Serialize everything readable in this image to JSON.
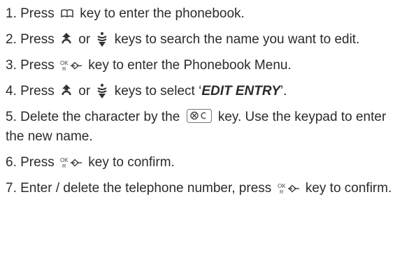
{
  "steps": [
    {
      "num": "1.",
      "parts": [
        {
          "t": "text",
          "v": " Press "
        },
        {
          "t": "icon",
          "name": "phonebook-key-icon"
        },
        {
          "t": "text",
          "v": " key to enter the phonebook."
        }
      ]
    },
    {
      "num": "2.",
      "parts": [
        {
          "t": "text",
          "v": " Press "
        },
        {
          "t": "icon",
          "name": "up-key-icon"
        },
        {
          "t": "text",
          "v": " or "
        },
        {
          "t": "icon",
          "name": "down-key-icon"
        },
        {
          "t": "text",
          "v": " keys to search the name you want to edit."
        }
      ]
    },
    {
      "num": "3.",
      "parts": [
        {
          "t": "text",
          "v": " Press "
        },
        {
          "t": "icon",
          "name": "ok-redial-key-icon"
        },
        {
          "t": "text",
          "v": " key to enter the Phonebook Menu."
        }
      ]
    },
    {
      "num": "4.",
      "parts": [
        {
          "t": "text",
          "v": " Press "
        },
        {
          "t": "icon",
          "name": "up-key-icon"
        },
        {
          "t": "text",
          "v": " or "
        },
        {
          "t": "icon",
          "name": "down-key-icon"
        },
        {
          "t": "text",
          "v": " keys to select ‘"
        },
        {
          "t": "em",
          "v": "EDIT ENTRY"
        },
        {
          "t": "text",
          "v": "’."
        }
      ]
    },
    {
      "num": "5.",
      "parts": [
        {
          "t": "text",
          "v": " Delete the character by the "
        },
        {
          "t": "icon",
          "name": "clear-key-icon"
        },
        {
          "t": "text",
          "v": " key. Use the keypad to enter the new name."
        }
      ]
    },
    {
      "num": "6.",
      "parts": [
        {
          "t": "text",
          "v": " Press "
        },
        {
          "t": "icon",
          "name": "ok-redial-key-icon"
        },
        {
          "t": "text",
          "v": " key to confirm."
        }
      ]
    },
    {
      "num": "7.",
      "parts": [
        {
          "t": "text",
          "v": " Enter / delete the telephone number, press "
        },
        {
          "t": "icon",
          "name": "ok-redial-key-icon"
        },
        {
          "t": "text",
          "v": " key to confirm."
        }
      ]
    }
  ]
}
